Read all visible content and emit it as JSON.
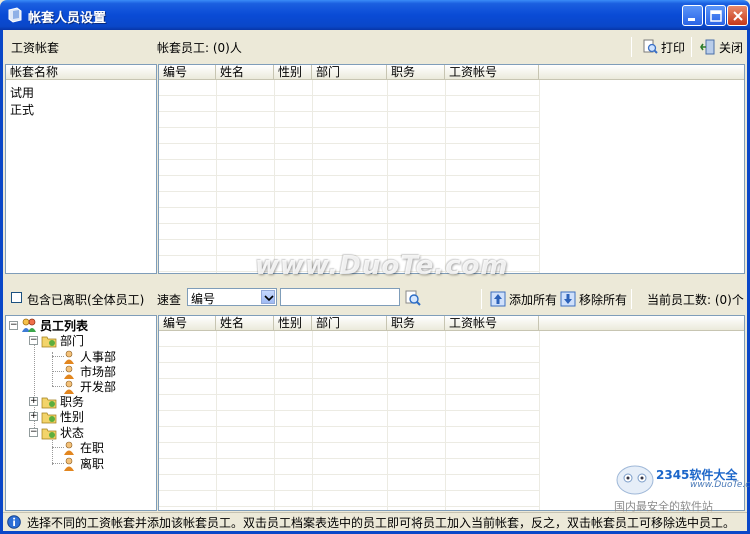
{
  "window": {
    "title": "帐套人员设置"
  },
  "toolbar": {
    "section_label": "工资帐套",
    "employee_count_label": "帐套员工: (0)人",
    "print_label": "打印",
    "close_label": "关闭"
  },
  "accounts_panel": {
    "header": "帐套名称",
    "items": [
      "试用",
      "正式"
    ]
  },
  "employee_columns": [
    "编号",
    "姓名",
    "性别",
    "部门",
    "职务",
    "工资帐号"
  ],
  "filter_bar": {
    "include_resigned_label": "包含已离职(全体员工)",
    "quick_search_label": "速查",
    "search_field_value": "编号",
    "search_input_value": "",
    "add_all_label": "添加所有",
    "remove_all_label": "移除所有",
    "current_count_label": "当前员工数: (0)个"
  },
  "tree": {
    "root": "员工列表",
    "department": "部门",
    "departments": [
      "人事部",
      "市场部",
      "开发部"
    ],
    "position": "职务",
    "gender": "性别",
    "status": "状态",
    "statuses": [
      "在职",
      "离职"
    ]
  },
  "status_bar": {
    "message": "选择不同的工资帐套并添加该帐套员工。双击员工档案表选中的员工即可将员工加入当前帐套，反之，双击帐套员工可移除选中员工。"
  },
  "watermarks": {
    "duote": "www.DuoTe.com",
    "duote_small": "www.DuoTe.com",
    "brand_2345": "2345软件大全",
    "brand_slogan": "国内最安全的软件站"
  }
}
